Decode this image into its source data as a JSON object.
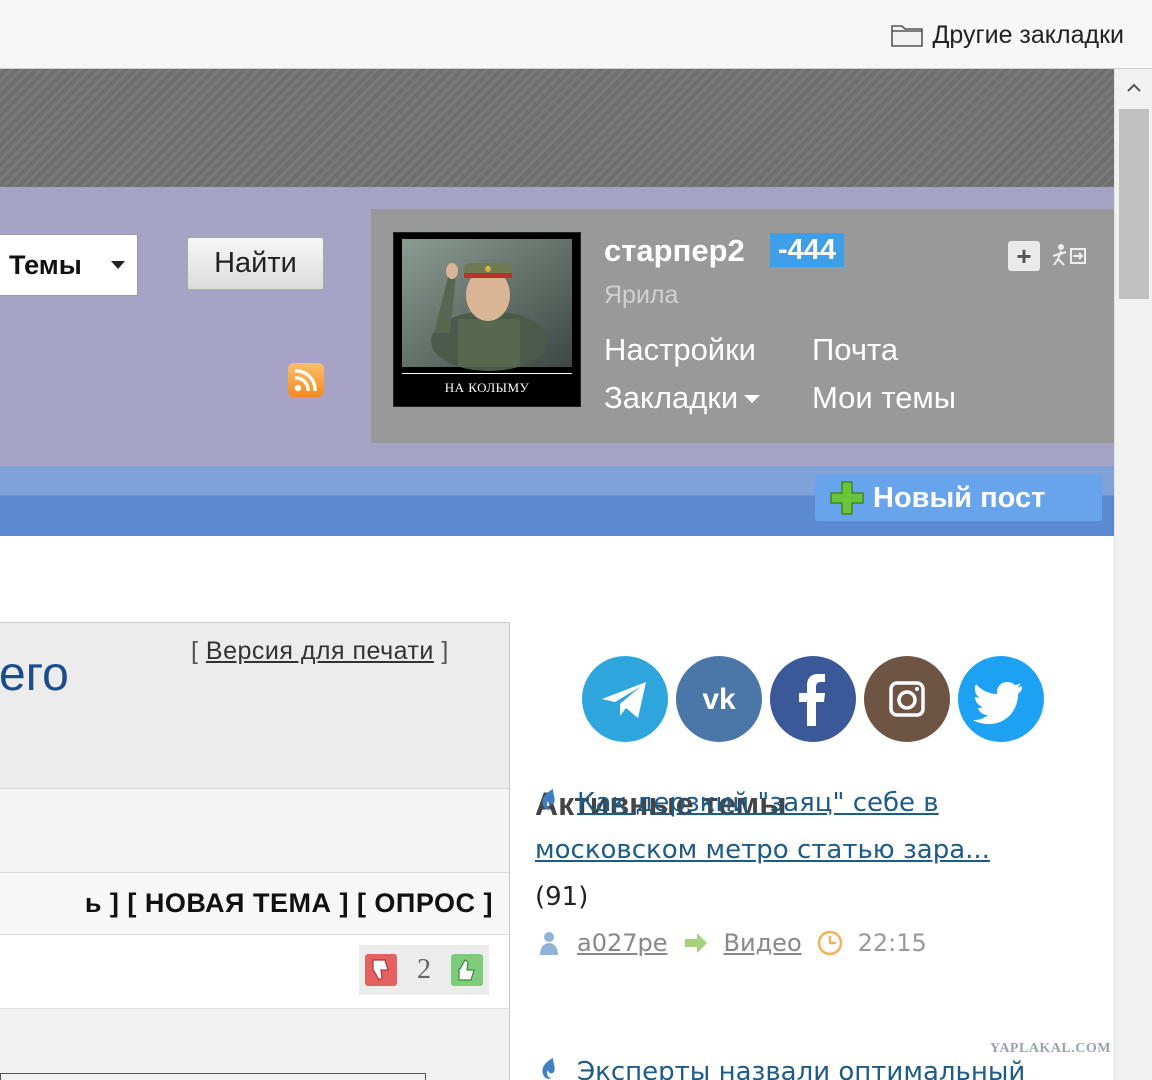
{
  "browser": {
    "other_bookmarks": "Другие закладки"
  },
  "search": {
    "scope_selected": "Темы",
    "find_button": "Найти"
  },
  "user": {
    "username": "старпер2",
    "karma": "-444",
    "status": "Ярила",
    "links": {
      "settings": "Настройки",
      "mail": "Почта",
      "bookmarks": "Закладки",
      "my_topics": "Мои темы"
    },
    "avatar_caption": "НА КОЛЫМУ"
  },
  "nav": {
    "new_post": "Новый пост"
  },
  "topic": {
    "title_fragment": "его",
    "print_open": "[",
    "print_link": "Версия для печати",
    "print_close": "]",
    "actions_text": "ь ] [ НОВАЯ ТЕМА ] [ ОПРОС ]",
    "rating": "2"
  },
  "sidebar": {
    "social": [
      "telegram",
      "vk",
      "facebook",
      "instagram",
      "twitter"
    ],
    "active_topics_title": "Активные темы",
    "items": [
      {
        "line1": "Как дерзкий \"заяц\" себе в",
        "line2": "московском метро статью зара...",
        "count": "(91)",
        "author": "a027pe",
        "section": "Видео",
        "time": "22:15"
      },
      {
        "line1": "Эксперты назвали оптимальный"
      }
    ]
  },
  "watermark": "YAPLAKAL.COM",
  "colors": {
    "header_band": "#a7a3c7",
    "user_panel": "#999999",
    "karma_badge": "#3f9ee8",
    "nav_blue": "#5c8ad2",
    "link_blue": "#1d5b88"
  }
}
